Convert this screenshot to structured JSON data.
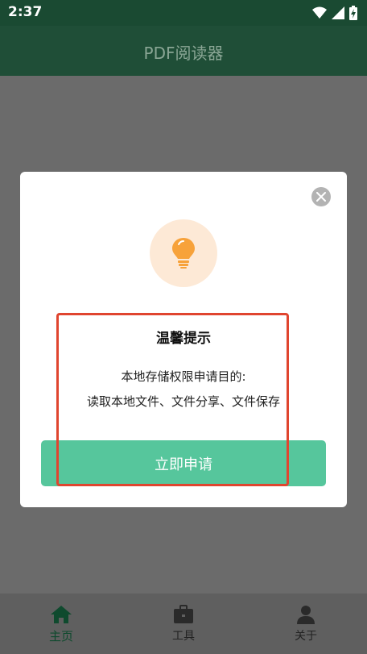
{
  "status_bar": {
    "time": "2:37"
  },
  "app_bar": {
    "title": "PDF阅读器"
  },
  "dialog": {
    "title": "温馨提示",
    "line1": "本地存储权限申请目的:",
    "line2": "读取本地文件、文件分享、文件保存",
    "apply_button": "立即申请"
  },
  "bottom_nav": {
    "items": [
      {
        "label": "主页",
        "icon": "home-icon",
        "active": true
      },
      {
        "label": "工具",
        "icon": "toolbox-icon",
        "active": false
      },
      {
        "label": "关于",
        "icon": "person-icon",
        "active": false
      }
    ]
  },
  "colors": {
    "app_bar": "#1f4e37",
    "accent_button": "#56c69c",
    "highlight": "#e0452f",
    "bulb": "#f7a23a"
  }
}
